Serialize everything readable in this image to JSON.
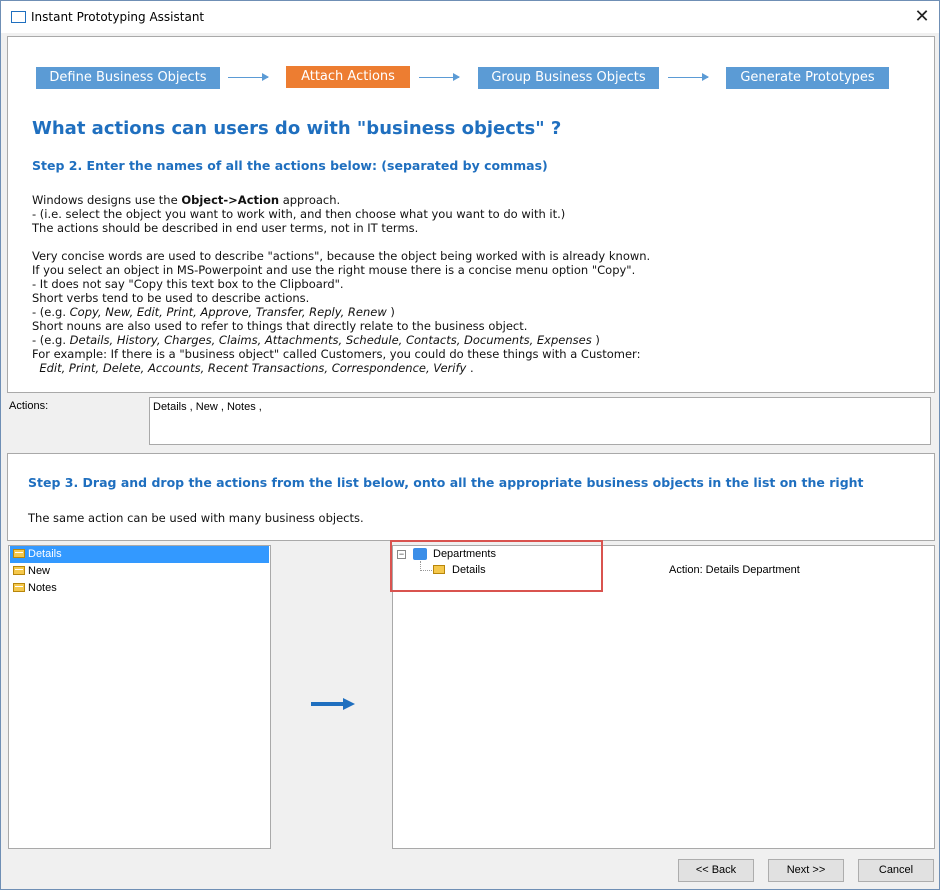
{
  "window": {
    "title": "Instant Prototyping Assistant",
    "close_glyph": "✕"
  },
  "steps": [
    {
      "label": "Define Business Objects"
    },
    {
      "label": "Attach Actions"
    },
    {
      "label": "Group Business Objects"
    },
    {
      "label": "Generate Prototypes"
    }
  ],
  "main": {
    "heading": "What actions can users do with \"business objects\" ?",
    "step2": "Step 2. Enter the names of all the actions below: (separated by commas)",
    "lines": {
      "l1a": "Windows designs use the ",
      "l1b": "Object->Action",
      "l1c": " approach.",
      "l2": "- (i.e. select the object you want to work with, and then choose what you want to do with it.)",
      "l3": "The actions should be described in end user terms, not in IT terms.",
      "l4": "Very concise words are used to describe \"actions\", because the object being worked with is already known.",
      "l5": "If you select an object in MS-Powerpoint and use the right mouse there is a concise menu option \"Copy\".",
      "l6": "- It does not say \"Copy this text box to the Clipboard\".",
      "l7": "Short verbs tend to be used to describe actions.",
      "l8a": "- (e.g. ",
      "l8b": "Copy, New, Edit, Print, Approve, Transfer, Reply, Renew",
      "l8c": " )",
      "l9": "Short nouns are also used to refer to things that directly relate to the business object.",
      "l10a": "- (e.g. ",
      "l10b": "Details, History, Charges, Claims, Attachments, Schedule, Contacts, Documents, Expenses",
      "l10c": " )",
      "l11": "For example: If there is a \"business object\" called Customers, you could do these things with a Customer:",
      "l12": "Edit, Print, Delete, Accounts, Recent Transactions, Correspondence, Verify",
      "l12end": " ."
    }
  },
  "actions": {
    "label": "Actions:",
    "value": "Details , New , Notes ,"
  },
  "step3": {
    "heading": "Step 3. Drag and drop the actions from the list below, onto all the appropriate business objects in the list on the right",
    "text": "The same action can be used with many business objects."
  },
  "action_list": [
    {
      "label": "Details",
      "selected": true
    },
    {
      "label": "New",
      "selected": false
    },
    {
      "label": "Notes",
      "selected": false
    }
  ],
  "tree": {
    "root": "Departments",
    "child": "Details",
    "action_text": "Action: Details Department",
    "expander": "−"
  },
  "buttons": {
    "back": "<< Back",
    "next": "Next >>",
    "cancel": "Cancel"
  },
  "colors": {
    "step_blue": "#5b9bd5",
    "step_active": "#ed7d31",
    "heading": "#1f6fbf",
    "highlight_box": "#d9534f"
  }
}
